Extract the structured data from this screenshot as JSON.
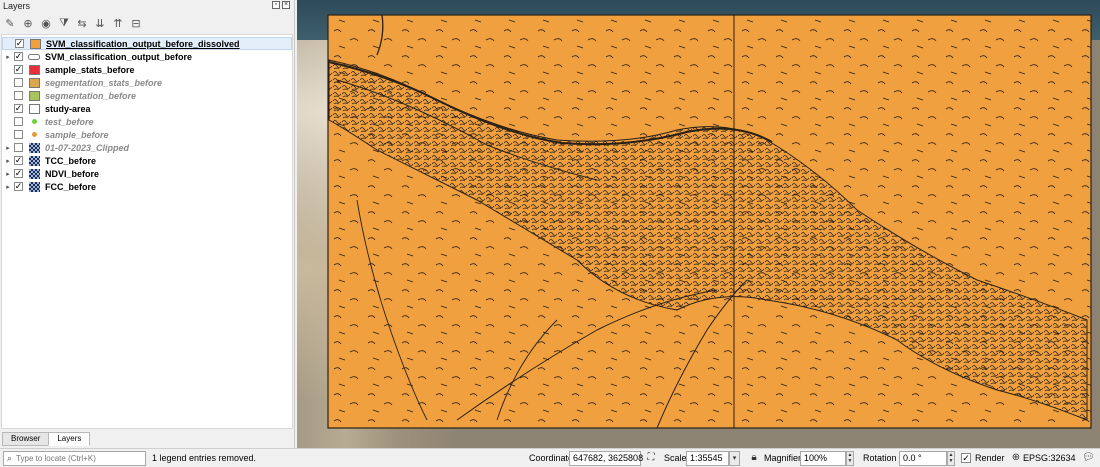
{
  "panel": {
    "title": "Layers",
    "layers": [
      {
        "name": "SVM_classification_output_before_dissolved",
        "checked": true,
        "visible_style": "on",
        "symbol": "fill",
        "color": "#f0a03e",
        "expandable": false,
        "selected": true
      },
      {
        "name": "SVM_classification_output_before",
        "checked": true,
        "visible_style": "on",
        "symbol": "vector-group",
        "expandable": true
      },
      {
        "name": "sample_stats_before",
        "checked": true,
        "visible_style": "on",
        "symbol": "fill",
        "color": "#e8303a",
        "expandable": false
      },
      {
        "name": "segmentation_stats_before",
        "checked": false,
        "visible_style": "off",
        "symbol": "fill",
        "color": "#d9a84e",
        "expandable": false
      },
      {
        "name": "segmentation_before",
        "checked": false,
        "visible_style": "off",
        "symbol": "fill",
        "color": "#a8c45a",
        "expandable": false
      },
      {
        "name": "study-area",
        "checked": true,
        "visible_style": "on",
        "symbol": "fill",
        "color": "#ffffff",
        "expandable": false
      },
      {
        "name": "test_before",
        "checked": false,
        "visible_style": "off",
        "symbol": "point",
        "color": "#6fcf3c",
        "expandable": false
      },
      {
        "name": "sample_before",
        "checked": false,
        "visible_style": "off",
        "symbol": "point",
        "color": "#e69a3a",
        "expandable": false
      },
      {
        "name": "01-07-2023_Clipped",
        "checked": false,
        "visible_style": "off",
        "symbol": "raster",
        "expandable": true
      },
      {
        "name": "TCC_before",
        "checked": true,
        "visible_style": "on",
        "symbol": "raster",
        "expandable": true
      },
      {
        "name": "NDVI_before",
        "checked": true,
        "visible_style": "on",
        "symbol": "raster",
        "expandable": true
      },
      {
        "name": "FCC_before",
        "checked": true,
        "visible_style": "on",
        "symbol": "raster",
        "expandable": true
      }
    ],
    "tabs": [
      "Browser",
      "Layers"
    ],
    "active_tab": "Layers"
  },
  "status": {
    "locate_placeholder": "Type to locate (Ctrl+K)",
    "message": "1 legend entries removed.",
    "coordinate_label": "Coordinate",
    "coordinate_value": "647682, 3625808",
    "scale_label": "Scale",
    "scale_value": "1:35545",
    "magnifier_label": "Magnifier",
    "magnifier_value": "100%",
    "rotation_label": "Rotation",
    "rotation_value": "0.0 °",
    "render_label": "Render",
    "crs_label": "EPSG:32634"
  },
  "colors": {
    "classification_fill": "#f0a03e",
    "outline": "#2a2016"
  }
}
